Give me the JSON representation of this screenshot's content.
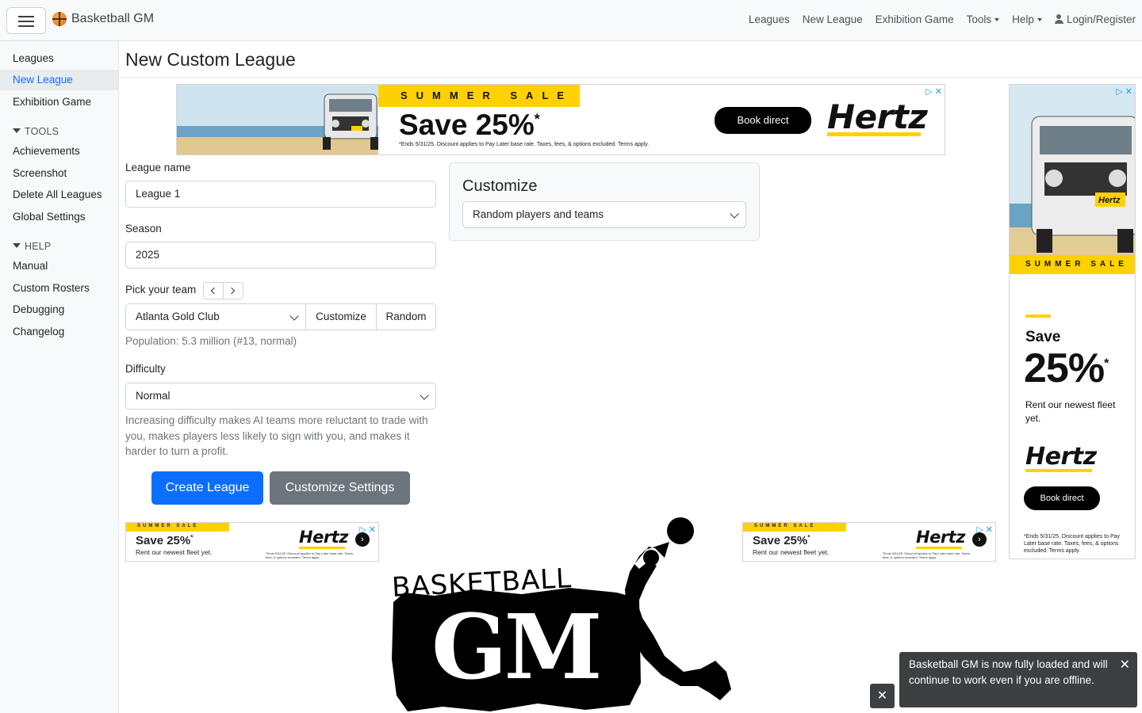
{
  "navbar": {
    "brand": "Basketball GM",
    "links": [
      "Leagues",
      "New League",
      "Exhibition Game"
    ],
    "tools": "Tools",
    "help": "Help",
    "login": "Login/Register"
  },
  "sidebar": {
    "items_top": [
      "Leagues",
      "New League",
      "Exhibition Game"
    ],
    "active": "New League",
    "tools_head": "TOOLS",
    "tools": [
      "Achievements",
      "Screenshot",
      "Delete All Leagues",
      "Global Settings"
    ],
    "help_head": "HELP",
    "help": [
      "Manual",
      "Custom Rosters",
      "Debugging",
      "Changelog"
    ]
  },
  "page": {
    "title": "New Custom League"
  },
  "form": {
    "league_name_label": "League name",
    "league_name_value": "League 1",
    "season_label": "Season",
    "season_value": "2025",
    "team_label": "Pick your team",
    "team_value": "Atlanta Gold Club",
    "customize_btn": "Customize",
    "random_btn": "Random",
    "population": "Population: 5.3 million (#13, normal)",
    "difficulty_label": "Difficulty",
    "difficulty_value": "Normal",
    "difficulty_help": "Increasing difficulty makes AI teams more reluctant to trade with you, makes players less likely to sign with you, and makes it harder to turn a profit.",
    "create_btn": "Create League",
    "settings_btn": "Customize Settings"
  },
  "customize_card": {
    "title": "Customize",
    "select_value": "Random players and teams"
  },
  "ads": {
    "top": {
      "sale": "SUMMER SALE",
      "headline": "Save 25%",
      "star": "*",
      "fine": "*Ends 5/31/25. Discount applies to Pay Later base rate. Taxes, fees, & options excluded. Terms apply.",
      "cta": "Book direct",
      "brand": "Hertz"
    },
    "side": {
      "sale": "SUMMER SALE",
      "save": "Save",
      "pct": "25%",
      "star": "*",
      "sub": "Rent our newest fleet yet.",
      "brand": "Hertz",
      "cta": "Book direct",
      "fine": "*Ends 5/31/25. Discount applies to Pay Later base rate. Taxes, fees, & options excluded. Terms apply."
    },
    "small": {
      "sale": "SUMMER SALE",
      "headline": "Save 25%",
      "star": "*",
      "sub": "Rent our newest fleet yet.",
      "brand": "Hertz",
      "fine": "*Ends 5/31/25. Discount applies to Pay Later base rate. Taxes, fees, & options excluded. Terms apply."
    }
  },
  "logo": {
    "word1": "BASKETBALL",
    "word2": "GM"
  },
  "toast": {
    "message": "Basketball GM is now fully loaded and will continue to work even if you are offline."
  },
  "icons": {
    "menu": "hamburger-icon",
    "brand": "basketball-icon",
    "user": "user-icon",
    "close": "close-icon"
  },
  "colors": {
    "primary": "#0d6efd",
    "secondary": "#6c757d",
    "hertz_yellow": "#ffd100",
    "toast_bg": "#3d3f42"
  }
}
